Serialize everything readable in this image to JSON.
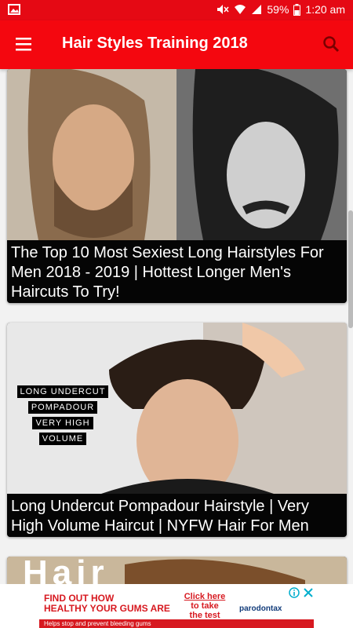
{
  "status": {
    "battery": "59%",
    "time": "1:20 am"
  },
  "appbar": {
    "title": "Hair Styles Training 2018"
  },
  "cards": [
    {
      "caption": "The Top 10 Most Sexiest Long Hairstyles For Men 2018 - 2019 | Hottest Longer Men's Haircuts To Try!"
    },
    {
      "caption": "Long Undercut Pompadour Hairstyle | Very High Volume Haircut | NYFW Hair For Men",
      "overlay": [
        "LONG UNDERCUT",
        "POMPADOUR",
        "VERY HIGH",
        "VOLUME"
      ]
    },
    {
      "overlay_title": "Hair"
    }
  ],
  "ad": {
    "headline_1": "FIND OUT HOW",
    "headline_2": "HEALTHY YOUR GUMS ARE",
    "cta_1": "Click here",
    "cta_2": "to take",
    "cta_3": "the test",
    "brand": "parodontax",
    "strip": "Helps stop and prevent bleeding gums"
  }
}
